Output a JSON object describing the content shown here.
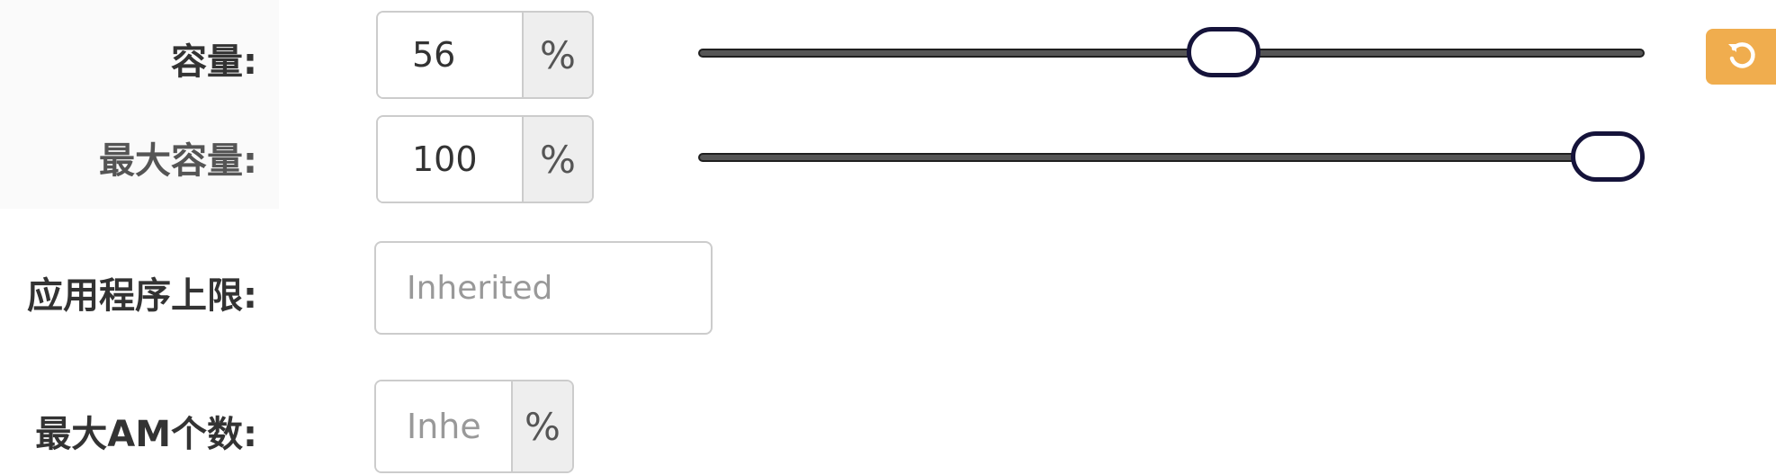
{
  "form": {
    "capacity": {
      "label": "容量:",
      "value": "56",
      "unit": "%",
      "slider_value_percent": 56
    },
    "max_capacity": {
      "label": "最大容量:",
      "value": "100",
      "unit": "%",
      "slider_value_percent": 100
    },
    "app_limit": {
      "label": "应用程序上限:",
      "placeholder": "Inherited"
    },
    "max_am": {
      "label": "最大AM个数:",
      "placeholder": "Inhe",
      "unit": "%"
    }
  },
  "icons": {
    "reset": "undo-icon"
  },
  "colors": {
    "reset_button": "#f0ad4e",
    "slider_handle_border": "#15133a",
    "label_text": "#333333"
  }
}
